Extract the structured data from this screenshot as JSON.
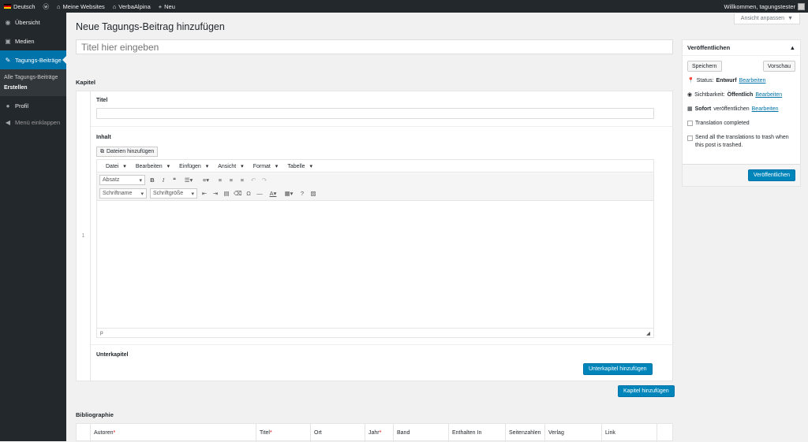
{
  "adminbar": {
    "language": "Deutsch",
    "my_sites": "Meine Websites",
    "site": "VerbaAlpina",
    "new": "Neu",
    "greeting": "Willkommen, tagungstester"
  },
  "sidebar": {
    "items": [
      {
        "label": "Übersicht",
        "icon": "dashboard-icon"
      },
      {
        "label": "Medien",
        "icon": "media-icon"
      },
      {
        "label": "Tagungs-Beiträge",
        "icon": "pin-icon"
      }
    ],
    "submenu": [
      "Alle Tagungs-Beiträge",
      "Erstellen"
    ],
    "profile": "Profil",
    "collapse": "Menü einklappen"
  },
  "screen_options": "Ansicht anpassen",
  "page_title": "Neue Tagungs-Beitrag hinzufügen",
  "title_placeholder": "Titel hier eingeben",
  "kapitel": {
    "label": "Kapitel",
    "number": "1",
    "titel_label": "Titel",
    "inhalt_label": "Inhalt",
    "media_button": "Dateien hinzufügen",
    "menubar": [
      "Datei",
      "Bearbeiten",
      "Einfügen",
      "Ansicht",
      "Format",
      "Tabelle"
    ],
    "format_select": "Absatz",
    "font_select": "Schriftname",
    "size_select": "Schriftgröße",
    "status_path": "p",
    "unterkapitel_label": "Unterkapitel",
    "add_unterkapitel": "Unterkapitel hinzufügen"
  },
  "add_kapitel": "Kapitel hinzufügen",
  "publish": {
    "title": "Veröffentlichen",
    "save": "Speichern",
    "preview": "Vorschau",
    "status_label": "Status:",
    "status_value": "Entwurf",
    "edit": "Bearbeiten",
    "visibility_label": "Sichtbarkeit:",
    "visibility_value": "Öffentlich",
    "schedule_strong": "Sofort",
    "schedule_rest": "veröffentlichen",
    "translation_completed": "Translation completed",
    "trash_translations": "Send all the translations to trash when this post is trashed.",
    "publish_button": "Veröffentlichen"
  },
  "bibliographie": {
    "label": "Bibliographie",
    "columns": [
      "Autoren",
      "Titel",
      "Ort",
      "Jahr",
      "Band",
      "Enthalten In",
      "Seitenzahlen",
      "Verlag",
      "Link"
    ],
    "required": [
      "Autoren",
      "Titel",
      "Jahr"
    ]
  },
  "colors": {
    "adminbar": "#23282d",
    "accent": "#0073aa",
    "primary_button": "#0085ba",
    "background": "#f1f1f1"
  }
}
